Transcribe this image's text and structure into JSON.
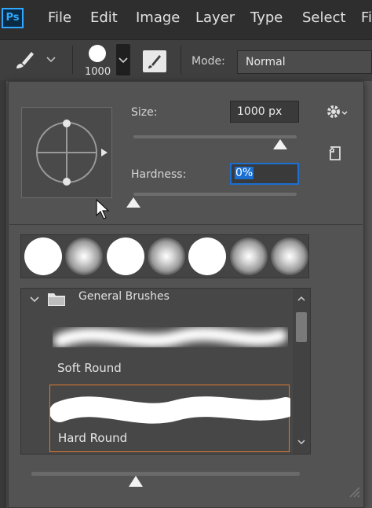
{
  "app": {
    "logo": "Ps"
  },
  "menubar": {
    "items": [
      "File",
      "Edit",
      "Image",
      "Layer",
      "Type",
      "Select",
      "Fi"
    ]
  },
  "options_bar": {
    "tool_icon": "brush-icon",
    "brush_size_label": "1000",
    "mode_label": "Mode:",
    "mode_value": "Normal"
  },
  "brush_panel": {
    "size_label": "Size:",
    "size_value": "1000 px",
    "size_slider_fraction": 0.9,
    "hardness_label": "Hardness:",
    "hardness_value": "0%",
    "hardness_slider_fraction": 0.0,
    "tips": [
      "hard",
      "soft",
      "hard",
      "soft",
      "hard",
      "soft",
      "soft"
    ],
    "group": {
      "name": "General Brushes",
      "expanded": true
    },
    "brushes": [
      {
        "name": "Soft Round",
        "selected": false
      },
      {
        "name": "Hard Round",
        "selected": true
      }
    ],
    "preview_size_fraction": 0.39,
    "selection_color": "#e07a2f",
    "highlight_color": "#1a6fd1"
  }
}
